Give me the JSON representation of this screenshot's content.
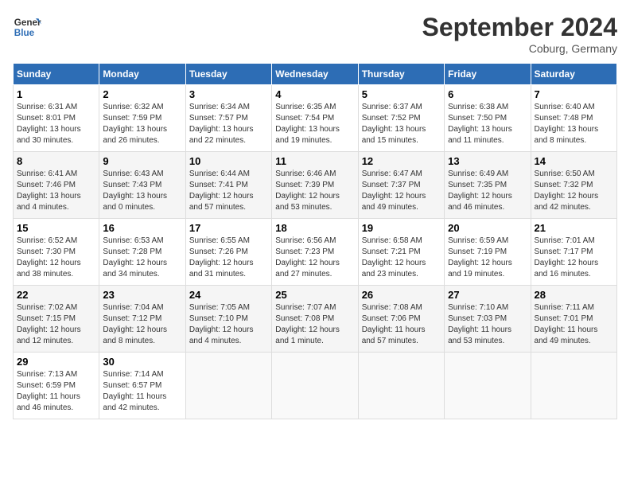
{
  "logo": {
    "text_general": "General",
    "text_blue": "Blue"
  },
  "title": "September 2024",
  "location": "Coburg, Germany",
  "headers": [
    "Sunday",
    "Monday",
    "Tuesday",
    "Wednesday",
    "Thursday",
    "Friday",
    "Saturday"
  ],
  "weeks": [
    [
      {
        "day": "1",
        "info": "Sunrise: 6:31 AM\nSunset: 8:01 PM\nDaylight: 13 hours\nand 30 minutes."
      },
      {
        "day": "2",
        "info": "Sunrise: 6:32 AM\nSunset: 7:59 PM\nDaylight: 13 hours\nand 26 minutes."
      },
      {
        "day": "3",
        "info": "Sunrise: 6:34 AM\nSunset: 7:57 PM\nDaylight: 13 hours\nand 22 minutes."
      },
      {
        "day": "4",
        "info": "Sunrise: 6:35 AM\nSunset: 7:54 PM\nDaylight: 13 hours\nand 19 minutes."
      },
      {
        "day": "5",
        "info": "Sunrise: 6:37 AM\nSunset: 7:52 PM\nDaylight: 13 hours\nand 15 minutes."
      },
      {
        "day": "6",
        "info": "Sunrise: 6:38 AM\nSunset: 7:50 PM\nDaylight: 13 hours\nand 11 minutes."
      },
      {
        "day": "7",
        "info": "Sunrise: 6:40 AM\nSunset: 7:48 PM\nDaylight: 13 hours\nand 8 minutes."
      }
    ],
    [
      {
        "day": "8",
        "info": "Sunrise: 6:41 AM\nSunset: 7:46 PM\nDaylight: 13 hours\nand 4 minutes."
      },
      {
        "day": "9",
        "info": "Sunrise: 6:43 AM\nSunset: 7:43 PM\nDaylight: 13 hours\nand 0 minutes."
      },
      {
        "day": "10",
        "info": "Sunrise: 6:44 AM\nSunset: 7:41 PM\nDaylight: 12 hours\nand 57 minutes."
      },
      {
        "day": "11",
        "info": "Sunrise: 6:46 AM\nSunset: 7:39 PM\nDaylight: 12 hours\nand 53 minutes."
      },
      {
        "day": "12",
        "info": "Sunrise: 6:47 AM\nSunset: 7:37 PM\nDaylight: 12 hours\nand 49 minutes."
      },
      {
        "day": "13",
        "info": "Sunrise: 6:49 AM\nSunset: 7:35 PM\nDaylight: 12 hours\nand 46 minutes."
      },
      {
        "day": "14",
        "info": "Sunrise: 6:50 AM\nSunset: 7:32 PM\nDaylight: 12 hours\nand 42 minutes."
      }
    ],
    [
      {
        "day": "15",
        "info": "Sunrise: 6:52 AM\nSunset: 7:30 PM\nDaylight: 12 hours\nand 38 minutes."
      },
      {
        "day": "16",
        "info": "Sunrise: 6:53 AM\nSunset: 7:28 PM\nDaylight: 12 hours\nand 34 minutes."
      },
      {
        "day": "17",
        "info": "Sunrise: 6:55 AM\nSunset: 7:26 PM\nDaylight: 12 hours\nand 31 minutes."
      },
      {
        "day": "18",
        "info": "Sunrise: 6:56 AM\nSunset: 7:23 PM\nDaylight: 12 hours\nand 27 minutes."
      },
      {
        "day": "19",
        "info": "Sunrise: 6:58 AM\nSunset: 7:21 PM\nDaylight: 12 hours\nand 23 minutes."
      },
      {
        "day": "20",
        "info": "Sunrise: 6:59 AM\nSunset: 7:19 PM\nDaylight: 12 hours\nand 19 minutes."
      },
      {
        "day": "21",
        "info": "Sunrise: 7:01 AM\nSunset: 7:17 PM\nDaylight: 12 hours\nand 16 minutes."
      }
    ],
    [
      {
        "day": "22",
        "info": "Sunrise: 7:02 AM\nSunset: 7:15 PM\nDaylight: 12 hours\nand 12 minutes."
      },
      {
        "day": "23",
        "info": "Sunrise: 7:04 AM\nSunset: 7:12 PM\nDaylight: 12 hours\nand 8 minutes."
      },
      {
        "day": "24",
        "info": "Sunrise: 7:05 AM\nSunset: 7:10 PM\nDaylight: 12 hours\nand 4 minutes."
      },
      {
        "day": "25",
        "info": "Sunrise: 7:07 AM\nSunset: 7:08 PM\nDaylight: 12 hours\nand 1 minute."
      },
      {
        "day": "26",
        "info": "Sunrise: 7:08 AM\nSunset: 7:06 PM\nDaylight: 11 hours\nand 57 minutes."
      },
      {
        "day": "27",
        "info": "Sunrise: 7:10 AM\nSunset: 7:03 PM\nDaylight: 11 hours\nand 53 minutes."
      },
      {
        "day": "28",
        "info": "Sunrise: 7:11 AM\nSunset: 7:01 PM\nDaylight: 11 hours\nand 49 minutes."
      }
    ],
    [
      {
        "day": "29",
        "info": "Sunrise: 7:13 AM\nSunset: 6:59 PM\nDaylight: 11 hours\nand 46 minutes."
      },
      {
        "day": "30",
        "info": "Sunrise: 7:14 AM\nSunset: 6:57 PM\nDaylight: 11 hours\nand 42 minutes."
      },
      {
        "day": "",
        "info": ""
      },
      {
        "day": "",
        "info": ""
      },
      {
        "day": "",
        "info": ""
      },
      {
        "day": "",
        "info": ""
      },
      {
        "day": "",
        "info": ""
      }
    ]
  ]
}
